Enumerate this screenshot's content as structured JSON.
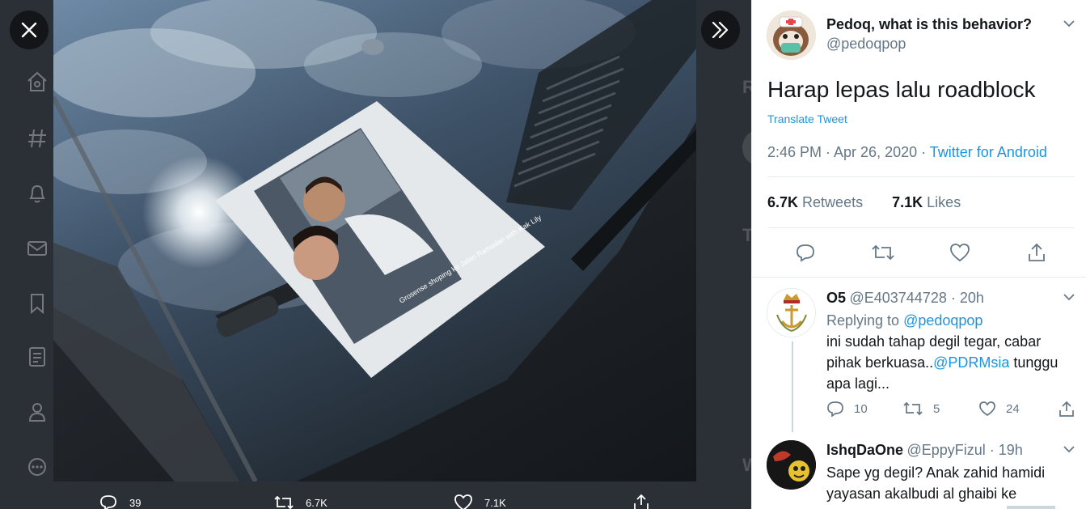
{
  "viewer": {
    "close_icon": "close-icon",
    "expand_icon": "chevron-double-right-icon",
    "actions": {
      "reply_count": "39",
      "retweet_count": "6.7K",
      "like_count": "7.1K"
    },
    "photo_caption": "Grosense shoping ke Jalan Ramadan with Kak Lily"
  },
  "tweet": {
    "author_name": "Pedoq, what is this behavior?",
    "author_handle": "@pedoqpop",
    "text": "Harap lepas lalu roadblock",
    "translate_label": "Translate Tweet",
    "timestamp": "2:46 PM · Apr 26, 2020 · ",
    "source": "Twitter for Android",
    "retweets_value": "6.7K",
    "retweets_label": "Retweets",
    "likes_value": "7.1K",
    "likes_label": "Likes"
  },
  "replies": [
    {
      "name": "O5",
      "handle": "@E403744728 · 20h",
      "replying_prefix": "Replying to ",
      "replying_to": "@pedoqpop",
      "text_before": "ini sudah tahap degil tegar, cabar pihak berkuasa..",
      "mention": "@PDRMsia",
      "text_after": " tunggu apa lagi...",
      "reply_count": "10",
      "retweet_count": "5",
      "like_count": "24"
    },
    {
      "name": "IshqDaOne",
      "handle": "@EppyFizul · 19h",
      "text": "Sape yg degil? Anak zahid hamidi yayasan akalbudi al ghaibi ke"
    }
  ],
  "colors": {
    "accent": "#1b95e0",
    "secondary_text": "#657786",
    "primary_text": "#14171a",
    "viewer_bg": "#2b3036"
  }
}
